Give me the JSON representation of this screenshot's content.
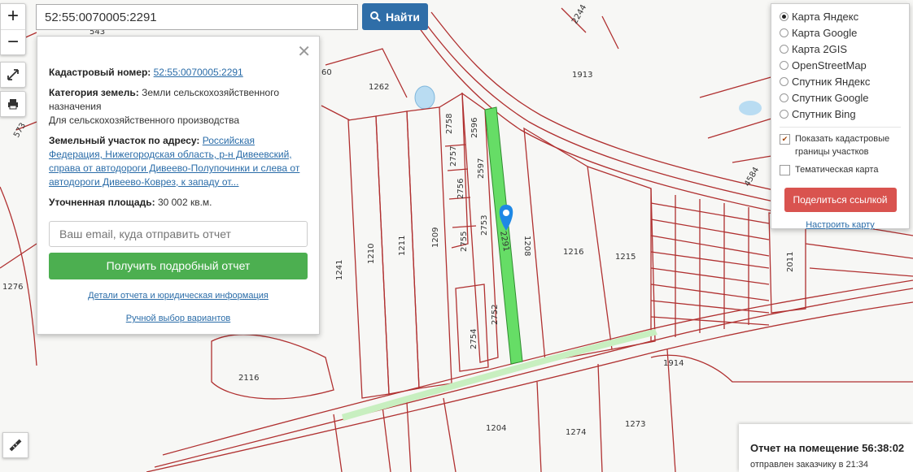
{
  "search": {
    "value": "52:55:0070005:2291",
    "button": "Найти"
  },
  "controls": {
    "zoom_in": "+",
    "zoom_out": "−"
  },
  "info": {
    "cad_label": "Кадастровый номер:",
    "cad_value": "52:55:0070005:2291",
    "cat_label": "Категория земель:",
    "cat_value": "Земли сельскохозяйственного назначения",
    "cat_use": "Для сельскохозяйственного производства",
    "addr_label": "Земельный участок по адресу:",
    "addr_value": "Российская Федерация, Нижегородская область, р-н Дивеевский, справа от автодороги Дивеево-Полупочинки и слева от автодороги Дивеево-Коврез, к западу от...",
    "area_label": "Уточненная площадь:",
    "area_value": "30 002 кв.м.",
    "email_placeholder": "Ваш email, куда отправить отчет",
    "report_button": "Получить подробный отчет",
    "details_link": "Детали отчета и юридическая информация",
    "manual_link": "Ручной выбор вариантов"
  },
  "layers": {
    "options": [
      {
        "label": "Карта Яндекс",
        "selected": true
      },
      {
        "label": "Карта Google",
        "selected": false
      },
      {
        "label": "Карта 2GIS",
        "selected": false
      },
      {
        "label": "OpenStreetMap",
        "selected": false
      },
      {
        "label": "Спутник Яндекс",
        "selected": false
      },
      {
        "label": "Спутник Google",
        "selected": false
      },
      {
        "label": "Спутник Bing",
        "selected": false
      }
    ],
    "show_borders": "Показать кадастровые границы участков",
    "thematic": "Тематическая карта",
    "share": "Поделиться ссылкой",
    "configure": "Настроить карту"
  },
  "map_labels": [
    "2244",
    "1262",
    "1913",
    "2758",
    "2596",
    "2757",
    "2597",
    "2756",
    "2755",
    "2753",
    "2291",
    "1210",
    "1211",
    "1209",
    "1241",
    "1208",
    "1216",
    "1215",
    "4584",
    "2011",
    "2752",
    "2754",
    "2116",
    "1914",
    "1204",
    "1274",
    "1273",
    "1276",
    "573",
    "543",
    "60"
  ],
  "report": {
    "title": "Отчет на помещение 56:38:02",
    "sub": "отправлен заказчику в 21:34"
  },
  "colors": {
    "parcel_line": "#b03030",
    "highlight": "#66dd66",
    "road": "#c04848",
    "water": "#b9dcf2",
    "primary": "#2f6ea8",
    "green": "#4caf50",
    "red": "#d9534f"
  }
}
